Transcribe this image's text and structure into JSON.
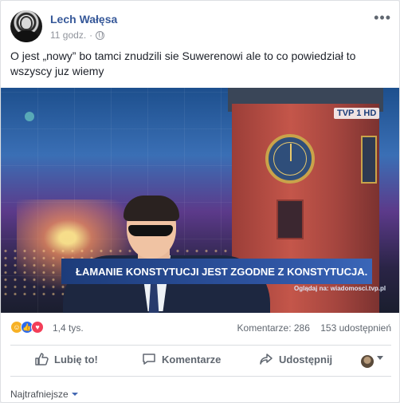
{
  "post": {
    "author": "Lech Wałęsa",
    "time": "11 godz.",
    "separator": "·",
    "text": "O jest „nowy” bo tamci znudzili sie Suwerenowi ale to co powiedział to wszyscy juz wiemy"
  },
  "image": {
    "channel_logo": "TVP 1 HD",
    "caption": "ŁAMANIE KONSTYTUCJI JEST ZGODNE Z KONSTYTUCJA.",
    "caption_sub": "Oglądaj na: wiadomosci.tvp.pl"
  },
  "stats": {
    "reactions_count": "1,4 tys.",
    "comments": "Komentarze: 286",
    "shares": "153 udostępnień",
    "reaction_icons": [
      "haha-icon",
      "like-icon",
      "love-icon"
    ]
  },
  "actions": {
    "like": "Lubię to!",
    "comment": "Komentarze",
    "share": "Udostępnij"
  },
  "footer": {
    "sort_label": "Najtrafniejsze"
  },
  "colors": {
    "link_blue": "#365899",
    "caption_blue": "#2f55a3",
    "text_gray": "#606770"
  }
}
